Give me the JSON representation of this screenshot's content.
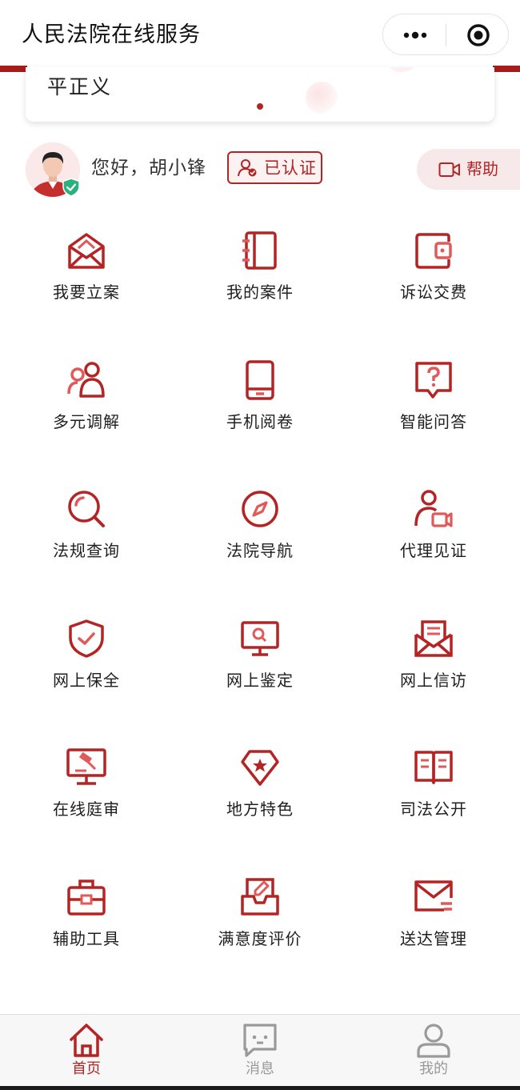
{
  "app": {
    "title": "人民法院在线服务"
  },
  "banner": {
    "text": "平正义"
  },
  "user": {
    "greeting": "您好，胡小锋",
    "auth_label": "已认证"
  },
  "help": {
    "label": "帮助"
  },
  "services": [
    {
      "label": "我要立案",
      "icon": "envelope-open-icon"
    },
    {
      "label": "我的案件",
      "icon": "notebook-icon"
    },
    {
      "label": "诉讼交费",
      "icon": "wallet-icon"
    },
    {
      "label": "多元调解",
      "icon": "people-icon"
    },
    {
      "label": "手机阅卷",
      "icon": "phone-icon"
    },
    {
      "label": "智能问答",
      "icon": "question-chat-icon"
    },
    {
      "label": "法规查询",
      "icon": "search-icon"
    },
    {
      "label": "法院导航",
      "icon": "compass-icon"
    },
    {
      "label": "代理见证",
      "icon": "person-video-icon"
    },
    {
      "label": "网上保全",
      "icon": "shield-check-icon"
    },
    {
      "label": "网上鉴定",
      "icon": "monitor-search-icon"
    },
    {
      "label": "网上信访",
      "icon": "letter-icon"
    },
    {
      "label": "在线庭审",
      "icon": "gavel-monitor-icon"
    },
    {
      "label": "地方特色",
      "icon": "star-gem-icon"
    },
    {
      "label": "司法公开",
      "icon": "open-book-icon"
    },
    {
      "label": "辅助工具",
      "icon": "toolbox-icon"
    },
    {
      "label": "满意度评价",
      "icon": "edit-tray-icon"
    },
    {
      "label": "送达管理",
      "icon": "mail-lines-icon"
    }
  ],
  "tabs": [
    {
      "label": "首页",
      "icon": "home-icon",
      "active": true
    },
    {
      "label": "消息",
      "icon": "message-icon",
      "active": false
    },
    {
      "label": "我的",
      "icon": "profile-icon",
      "active": false
    }
  ],
  "colors": {
    "accent": "#b52424",
    "inactive": "#999999",
    "tabbar_bg": "#f7f7f7"
  }
}
